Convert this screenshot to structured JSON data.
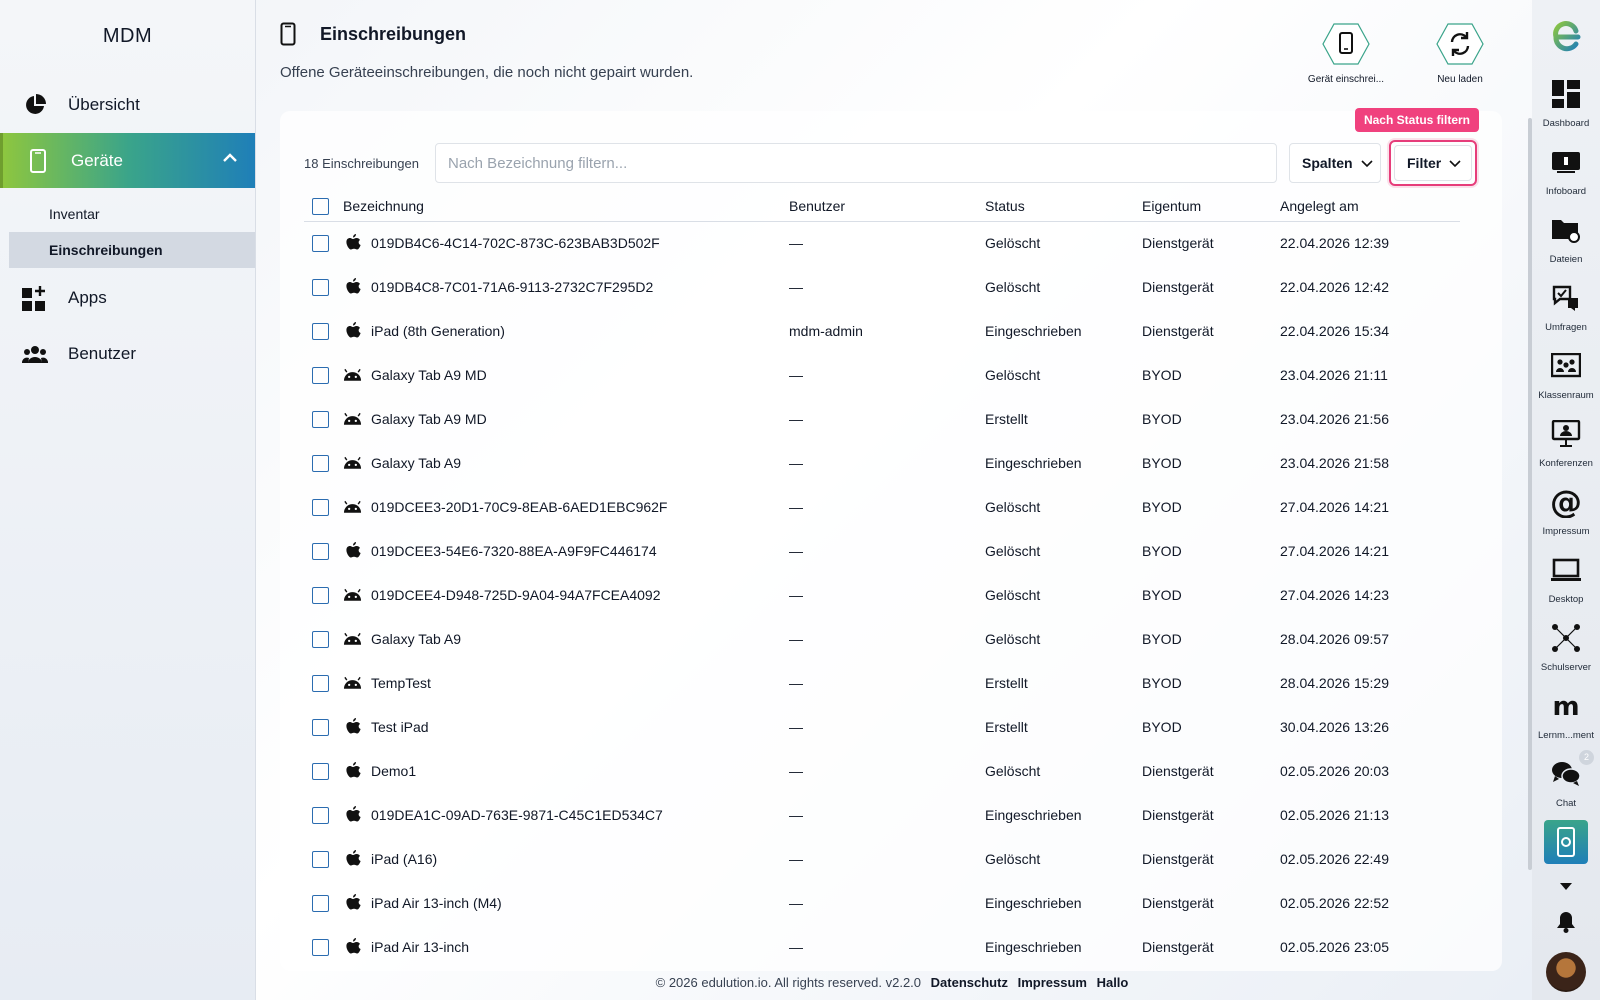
{
  "sidebar": {
    "title": "MDM",
    "items": [
      {
        "label": "Übersicht",
        "icon": "pie-chart-icon"
      },
      {
        "label": "Geräte",
        "icon": "phone-icon",
        "active": true,
        "children": [
          {
            "label": "Inventar"
          },
          {
            "label": "Einschreibungen",
            "selected": true
          }
        ]
      },
      {
        "label": "Apps",
        "icon": "apps-grid-icon"
      },
      {
        "label": "Benutzer",
        "icon": "users-icon"
      }
    ]
  },
  "page": {
    "title": "Einschreibungen",
    "subtitle": "Offene Geräteeinschreibungen, die noch nicht gepairt wurden."
  },
  "actions": {
    "enroll_label": "Gerät einschrei...",
    "reload_label": "Neu laden"
  },
  "toolbar": {
    "count": "18 Einschreibungen",
    "search_placeholder": "Nach Bezeichnung filtern...",
    "columns_label": "Spalten",
    "filter_label": "Filter",
    "filter_tooltip": "Nach Status filtern"
  },
  "table": {
    "headers": [
      "Bezeichnung",
      "Benutzer",
      "Status",
      "Eigentum",
      "Angelegt am"
    ],
    "rows": [
      {
        "os": "apple",
        "name": "019DB4C6-4C14-702C-873C-623BAB3D502F",
        "user": "—",
        "status": "Gelöscht",
        "owner": "Dienstgerät",
        "created": "22.04.2026 12:39"
      },
      {
        "os": "apple",
        "name": "019DB4C8-7C01-71A6-9113-2732C7F295D2",
        "user": "—",
        "status": "Gelöscht",
        "owner": "Dienstgerät",
        "created": "22.04.2026 12:42"
      },
      {
        "os": "apple",
        "name": "iPad (8th Generation)",
        "user": "mdm-admin",
        "status": "Eingeschrieben",
        "owner": "Dienstgerät",
        "created": "22.04.2026 15:34"
      },
      {
        "os": "android",
        "name": "Galaxy Tab A9 MD",
        "user": "—",
        "status": "Gelöscht",
        "owner": "BYOD",
        "created": "23.04.2026 21:11"
      },
      {
        "os": "android",
        "name": "Galaxy Tab A9 MD",
        "user": "—",
        "status": "Erstellt",
        "owner": "BYOD",
        "created": "23.04.2026 21:56"
      },
      {
        "os": "android",
        "name": "Galaxy Tab A9",
        "user": "—",
        "status": "Eingeschrieben",
        "owner": "BYOD",
        "created": "23.04.2026 21:58"
      },
      {
        "os": "android",
        "name": "019DCEE3-20D1-70C9-8EAB-6AED1EBC962F",
        "user": "—",
        "status": "Gelöscht",
        "owner": "BYOD",
        "created": "27.04.2026 14:21"
      },
      {
        "os": "apple",
        "name": "019DCEE3-54E6-7320-88EA-A9F9FC446174",
        "user": "—",
        "status": "Gelöscht",
        "owner": "BYOD",
        "created": "27.04.2026 14:21"
      },
      {
        "os": "android",
        "name": "019DCEE4-D948-725D-9A04-94A7FCEA4092",
        "user": "—",
        "status": "Gelöscht",
        "owner": "BYOD",
        "created": "27.04.2026 14:23"
      },
      {
        "os": "android",
        "name": "Galaxy Tab A9",
        "user": "—",
        "status": "Gelöscht",
        "owner": "BYOD",
        "created": "28.04.2026 09:57"
      },
      {
        "os": "android",
        "name": "TempTest",
        "user": "—",
        "status": "Erstellt",
        "owner": "BYOD",
        "created": "28.04.2026 15:29"
      },
      {
        "os": "apple",
        "name": "Test iPad",
        "user": "—",
        "status": "Erstellt",
        "owner": "BYOD",
        "created": "30.04.2026 13:26"
      },
      {
        "os": "apple",
        "name": "Demo1",
        "user": "—",
        "status": "Gelöscht",
        "owner": "Dienstgerät",
        "created": "02.05.2026 20:03"
      },
      {
        "os": "apple",
        "name": "019DEA1C-09AD-763E-9871-C45C1ED534C7",
        "user": "—",
        "status": "Eingeschrieben",
        "owner": "Dienstgerät",
        "created": "02.05.2026 21:13"
      },
      {
        "os": "apple",
        "name": "iPad (A16)",
        "user": "—",
        "status": "Gelöscht",
        "owner": "Dienstgerät",
        "created": "02.05.2026 22:49"
      },
      {
        "os": "apple",
        "name": "iPad Air 13-inch (M4)",
        "user": "—",
        "status": "Eingeschrieben",
        "owner": "Dienstgerät",
        "created": "02.05.2026 22:52"
      },
      {
        "os": "apple",
        "name": "iPad Air 13-inch",
        "user": "—",
        "status": "Eingeschrieben",
        "owner": "Dienstgerät",
        "created": "02.05.2026 23:05"
      }
    ]
  },
  "footer": {
    "copyright": "© 2026 edulution.io. All rights reserved. v2.2.0",
    "links": [
      "Datenschutz",
      "Impressum",
      "Hallo"
    ]
  },
  "rail": {
    "items": [
      {
        "label": "Dashboard",
        "icon": "dashboard-icon"
      },
      {
        "label": "Infoboard",
        "icon": "infoboard-icon"
      },
      {
        "label": "Dateien",
        "icon": "files-icon"
      },
      {
        "label": "Umfragen",
        "icon": "surveys-icon"
      },
      {
        "label": "Klassenraum",
        "icon": "classroom-icon"
      },
      {
        "label": "Konferenzen",
        "icon": "conference-icon"
      },
      {
        "label": "Impressum",
        "icon": "at-icon"
      },
      {
        "label": "Desktop",
        "icon": "laptop-icon"
      },
      {
        "label": "Schulserver",
        "icon": "network-icon"
      },
      {
        "label": "Lernm...ment",
        "icon": "moodle-icon"
      },
      {
        "label": "Chat",
        "icon": "chat-icon",
        "badge": "2"
      }
    ],
    "mdm_label": "MDM"
  },
  "colors": {
    "accent_gradient_start": "#8dc63f",
    "accent_gradient_end": "#1f7fb8",
    "highlight": "#e63d7a",
    "checkbox": "#2b6cb0"
  }
}
